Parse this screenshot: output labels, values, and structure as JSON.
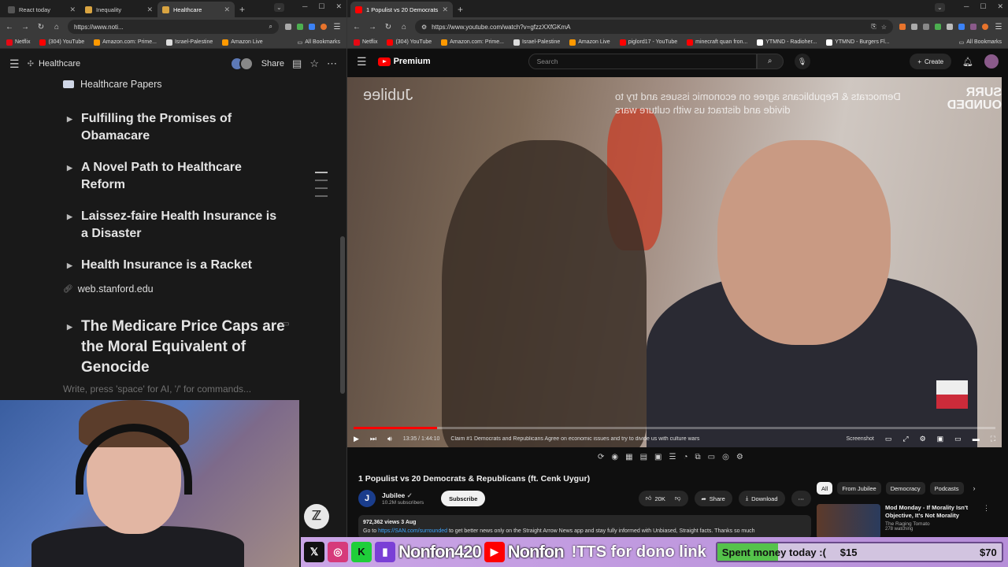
{
  "left_browser": {
    "tabs": [
      {
        "label": "React today",
        "active": false,
        "fav_color": "#555555"
      },
      {
        "label": "Inequality",
        "active": false,
        "fav_color": "#d9a441"
      },
      {
        "label": "Healthcare",
        "active": true,
        "fav_color": "#d9a441"
      }
    ],
    "url": "https://www.noti...",
    "bookmarks": [
      {
        "label": "Netflix",
        "color": "#e50914"
      },
      {
        "label": "(304) YouTube",
        "color": "#ff0000"
      },
      {
        "label": "Amazon.com: Prime...",
        "color": "#ff9900"
      },
      {
        "label": "Israel-Palestine",
        "color": "#dddddd"
      },
      {
        "label": "Amazon Live",
        "color": "#ff9900"
      }
    ],
    "all_bookmarks": "All Bookmarks"
  },
  "notion": {
    "page_title": "Healthcare",
    "share_label": "Share",
    "heading": "Healthcare Papers",
    "toggles": [
      "Fulfilling the Promises of Obamacare",
      "A Novel Path to Healthcare Reform",
      "Laissez-faire Health Insurance is a Disaster",
      "Health Insurance is a Racket"
    ],
    "link": "web.stanford.edu",
    "big_toggle": "The Medicare Price Caps are the Moral Equivalent of Genocide",
    "placeholder": "Write, press 'space' for AI, '/' for commands..."
  },
  "right_browser": {
    "tabs": [
      {
        "label": "1 Populist vs 20 Democrats & R",
        "active": true,
        "fav_color": "#ff0000"
      }
    ],
    "url": "https://www.youtube.com/watch?v=gfzzXXfGKmA",
    "bookmarks": [
      {
        "label": "Netflix",
        "color": "#e50914"
      },
      {
        "label": "(304) YouTube",
        "color": "#ff0000"
      },
      {
        "label": "Amazon.com: Prime...",
        "color": "#ff9900"
      },
      {
        "label": "Israel-Palestine",
        "color": "#dddddd"
      },
      {
        "label": "Amazon Live",
        "color": "#ff9900"
      },
      {
        "label": "piglord17 - YouTube",
        "color": "#ff0000"
      },
      {
        "label": "minecraft quan fron...",
        "color": "#ff0000"
      },
      {
        "label": "YTMND - Radioher...",
        "color": "#ffffff"
      },
      {
        "label": "YTMND - Burgers Fl...",
        "color": "#ffffff"
      }
    ],
    "all_bookmarks": "All Bookmarks"
  },
  "youtube": {
    "logo_text": "Premium",
    "search_placeholder": "Search",
    "create_label": "Create",
    "overlay": {
      "watermark": "Jubilee",
      "caption": "Democrats & Republicans agree on economic issues and try to divide and distract us with culture wars",
      "brand": "SURR OUNDED"
    },
    "player": {
      "timecode": "13:35 / 1:44:10",
      "chapter": "Claim #1 Democrats and Republicans Agree on economic issues and try to divide us with culture wars",
      "progress": 0.13,
      "screenshot_label": "Screenshot"
    },
    "video_title": "1 Populist vs 20 Democrats & Republicans (ft. Cenk Uygur)",
    "channel": {
      "name": "Jubilee",
      "subscribers": "10.2M subscribers",
      "avatar_letter": "J"
    },
    "subscribe_label": "Subscribe",
    "likes": "20K",
    "share_label": "Share",
    "download_label": "Download",
    "description": {
      "meta": "972,362 views  3 Aug",
      "prefix": "Go to ",
      "link": "https://SAN.com/surrounded",
      "rest": " to get better news only on the Straight Arrow News app and stay fully informed with Unbiased, Straight facts. Thanks so much"
    },
    "chips": [
      "All",
      "From Jubilee",
      "Democracy",
      "Podcasts"
    ],
    "recommendation": {
      "title": "Mod Monday - If Morality Isn't Objective, It's Not Morality",
      "channel": "The Raging Tomato",
      "views": "278 watching"
    }
  },
  "stream_overlay": {
    "handle1": "Nonfon420",
    "handle2": "Nonfon",
    "tts": "!TTS for dono link",
    "goal_label": "Spent money today :(",
    "current": "$15",
    "goal": "$70",
    "progress": 0.214,
    "colors": {
      "bar": "#b68ed8",
      "fill": "#55c24b"
    }
  }
}
